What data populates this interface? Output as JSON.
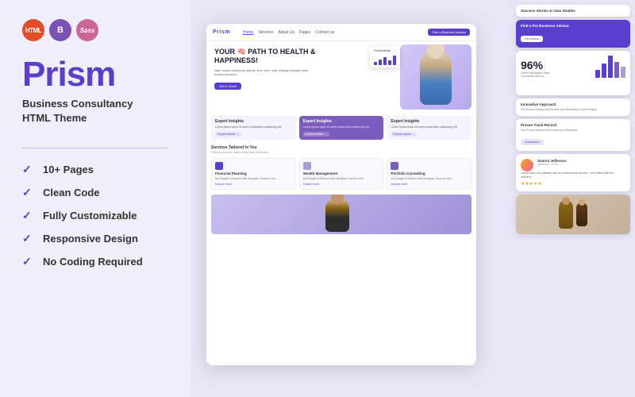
{
  "left": {
    "badges": {
      "html": "HTML",
      "bootstrap": "B",
      "sass": "Sass"
    },
    "brand": "Prism",
    "subtitle": "Business Consultancy\nHTML Theme",
    "features": [
      {
        "id": "pages",
        "label": "10+ Pages"
      },
      {
        "id": "clean-code",
        "label": "Clean Code"
      },
      {
        "id": "customizable",
        "label": "Fully Customizable"
      },
      {
        "id": "responsive",
        "label": "Responsive Design"
      },
      {
        "id": "no-coding",
        "label": "No Coding Required"
      }
    ]
  },
  "preview": {
    "nav": {
      "logo": "Prism",
      "links": [
        "Home",
        "Services",
        "About Us",
        "Pages",
        "Contact us"
      ],
      "cta": "Find a Business Advisor"
    },
    "hero": {
      "title": "YOUR 🧠 PATH TO HEALTH & HAPPINESS!",
      "subtitle": "Nam varius adipiscing aliquet quis lorem sed, Aliquam feugiat diam nullam pharetra.",
      "cta": "Get in Touch",
      "productivity_label": "Productivity"
    },
    "insight_cards": [
      {
        "title": "Expert Insights",
        "body": "Lorem ipsum dolor sit amet consectetur",
        "link": "Explore Article →"
      },
      {
        "title": "Expert Insights",
        "body": "Lorem ipsum dolor sit amet consectetur",
        "link": "Explore Article →"
      },
      {
        "title": "Expert Insights",
        "body": "Lorem ipsum dolor sit amet consectetur",
        "link": "Explore Article →"
      }
    ],
    "services": {
      "label": "Helping people make informed decisions",
      "title": "Services Tailored to You",
      "cards": [
        {
          "title": "Financial Planning",
          "body": "But fraught confusion with thoughts. Explore now.",
          "link": "Explore more"
        },
        {
          "title": "Wealth Management",
          "body": "But fraught confusion with thoughts. Explore now.",
          "link": "Explore more"
        },
        {
          "title": "Portfolio Consulting",
          "body": "But fraught confusion with thoughts. Explore now.",
          "link": "Explore more"
        }
      ]
    }
  },
  "side": {
    "success_label": "Success Stories & Case Studies",
    "find_advisor": "Find a Pro Business Advisor",
    "find_btn": "Get Started",
    "percent": "96%",
    "approach_title": "Innovative Approach",
    "approach_body": "Our Proven Method will Rocket your Business to New Heights",
    "track_title": "Proven Track Record",
    "track_body": "Our Proven Method will Rocket your Business",
    "track_btn": "Guaranteed",
    "review_name": "Samira Jefferson",
    "review_handle": "@samira · 12/31",
    "review_text": "I have been very pleased with the professional service. I am thrilled with the outcome.",
    "review_stars": "★★★★★"
  },
  "colors": {
    "brand": "#5a3fcf",
    "accent": "#7c5cbf",
    "bg": "#f0eef8"
  }
}
